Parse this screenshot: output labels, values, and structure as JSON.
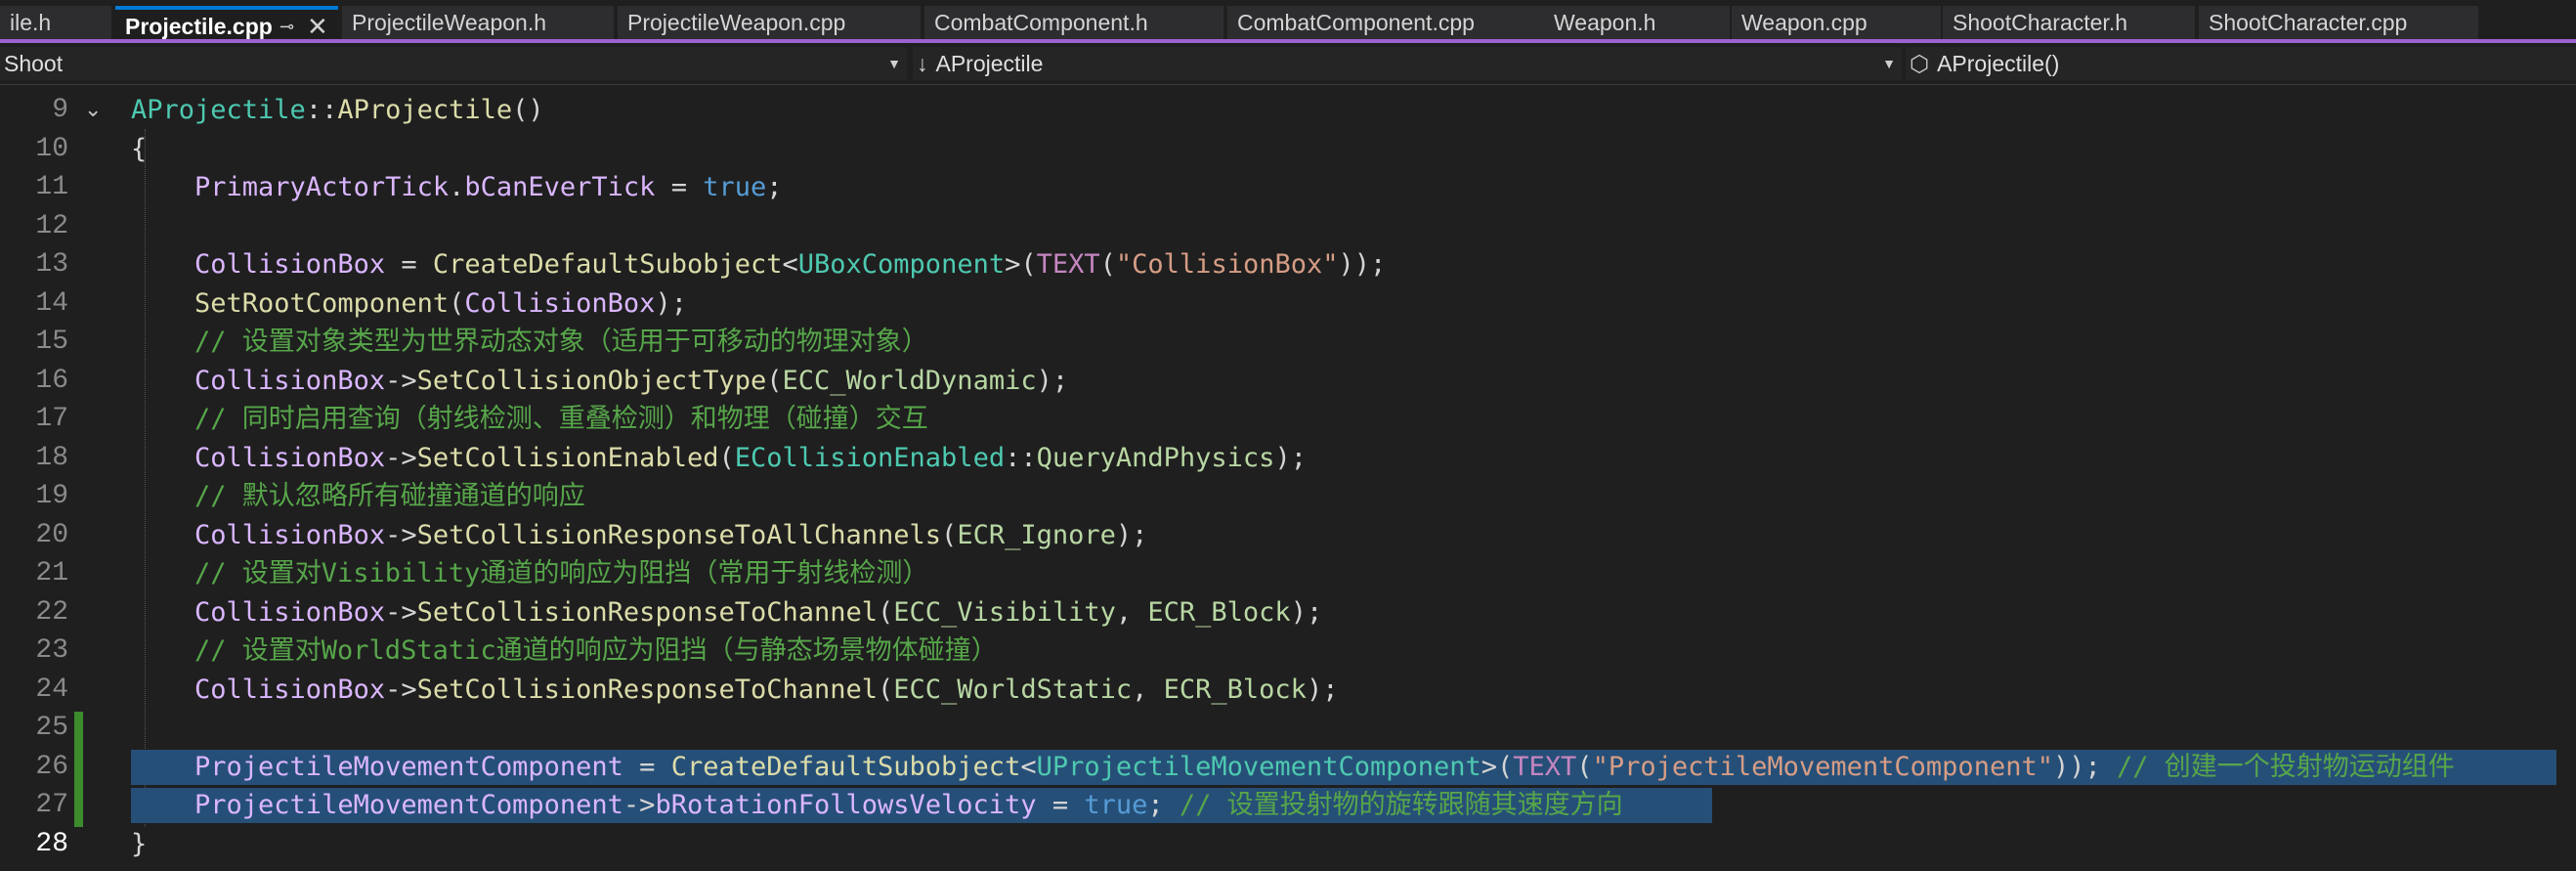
{
  "tabs": [
    {
      "label": "ile.h"
    },
    {
      "label": "Projectile.cpp",
      "active": true,
      "pin_icon": "pin-icon",
      "close_icon": "close-icon"
    },
    {
      "label": "ProjectileWeapon.h"
    },
    {
      "label": "ProjectileWeapon.cpp"
    },
    {
      "label": "CombatComponent.h"
    },
    {
      "label": "CombatComponent.cpp"
    },
    {
      "label": "Weapon.h"
    },
    {
      "label": "Weapon.cpp"
    },
    {
      "label": "ShootCharacter.h"
    },
    {
      "label": "ShootCharacter.cpp"
    }
  ],
  "nav": {
    "project": "Shoot",
    "scope": "AProjectile",
    "scope_icon": "down-arrow-icon",
    "member": "AProjectile()",
    "member_icon": "cube-icon"
  },
  "colors": {
    "keyword": "#569cd6",
    "type": "#4ec9b0",
    "function": "#dcdcaa",
    "member": "#dab6ff",
    "string": "#d69d85",
    "macro": "#c586c0",
    "comment": "#57a64a",
    "enum": "#b8d7a3",
    "selection": "#264f78",
    "change_bar": "#3c8c2e",
    "tab_accent": "#9d62cf"
  },
  "code": {
    "lines": [
      {
        "n": "9",
        "tokens": [
          {
            "t": "AProjectile",
            "c": "ty"
          },
          {
            "t": "::",
            "c": "pu"
          },
          {
            "t": "AProjectile",
            "c": "fn"
          },
          {
            "t": "()",
            "c": "pu"
          }
        ]
      },
      {
        "n": "10",
        "tokens": [
          {
            "t": "{",
            "c": "pu"
          }
        ]
      },
      {
        "n": "11",
        "tokens": [
          {
            "t": "    PrimaryActorTick",
            "c": "mb"
          },
          {
            "t": ".",
            "c": "pu"
          },
          {
            "t": "bCanEverTick",
            "c": "mb"
          },
          {
            "t": " = ",
            "c": "pu"
          },
          {
            "t": "true",
            "c": "kw"
          },
          {
            "t": ";",
            "c": "pu"
          }
        ]
      },
      {
        "n": "12",
        "tokens": []
      },
      {
        "n": "13",
        "tokens": [
          {
            "t": "    CollisionBox",
            "c": "mb"
          },
          {
            "t": " = ",
            "c": "pu"
          },
          {
            "t": "CreateDefaultSubobject",
            "c": "fn"
          },
          {
            "t": "<",
            "c": "pu"
          },
          {
            "t": "UBoxComponent",
            "c": "ty"
          },
          {
            "t": ">(",
            "c": "pu"
          },
          {
            "t": "TEXT",
            "c": "mc"
          },
          {
            "t": "(",
            "c": "pu"
          },
          {
            "t": "\"CollisionBox\"",
            "c": "st"
          },
          {
            "t": "));",
            "c": "pu"
          }
        ]
      },
      {
        "n": "14",
        "tokens": [
          {
            "t": "    SetRootComponent",
            "c": "fn"
          },
          {
            "t": "(",
            "c": "pu"
          },
          {
            "t": "CollisionBox",
            "c": "mb"
          },
          {
            "t": ");",
            "c": "pu"
          }
        ]
      },
      {
        "n": "15",
        "tokens": [
          {
            "t": "    // 设置对象类型为世界动态对象（适用于可移动的物理对象）",
            "c": "cm"
          }
        ]
      },
      {
        "n": "16",
        "tokens": [
          {
            "t": "    CollisionBox",
            "c": "mb"
          },
          {
            "t": "->",
            "c": "pu"
          },
          {
            "t": "SetCollisionObjectType",
            "c": "fn"
          },
          {
            "t": "(",
            "c": "pu"
          },
          {
            "t": "ECC_WorldDynamic",
            "c": "en"
          },
          {
            "t": ");",
            "c": "pu"
          }
        ]
      },
      {
        "n": "17",
        "tokens": [
          {
            "t": "    // 同时启用查询（射线检测、重叠检测）和物理（碰撞）交互",
            "c": "cm"
          }
        ]
      },
      {
        "n": "18",
        "tokens": [
          {
            "t": "    CollisionBox",
            "c": "mb"
          },
          {
            "t": "->",
            "c": "pu"
          },
          {
            "t": "SetCollisionEnabled",
            "c": "fn"
          },
          {
            "t": "(",
            "c": "pu"
          },
          {
            "t": "ECollisionEnabled",
            "c": "ty"
          },
          {
            "t": "::",
            "c": "pu"
          },
          {
            "t": "QueryAndPhysics",
            "c": "en"
          },
          {
            "t": ");",
            "c": "pu"
          }
        ]
      },
      {
        "n": "19",
        "tokens": [
          {
            "t": "    // 默认忽略所有碰撞通道的响应",
            "c": "cm"
          }
        ]
      },
      {
        "n": "20",
        "tokens": [
          {
            "t": "    CollisionBox",
            "c": "mb"
          },
          {
            "t": "->",
            "c": "pu"
          },
          {
            "t": "SetCollisionResponseToAllChannels",
            "c": "fn"
          },
          {
            "t": "(",
            "c": "pu"
          },
          {
            "t": "ECR_Ignore",
            "c": "en"
          },
          {
            "t": ");",
            "c": "pu"
          }
        ]
      },
      {
        "n": "21",
        "tokens": [
          {
            "t": "    // 设置对Visibility通道的响应为阻挡（常用于射线检测）",
            "c": "cm"
          }
        ]
      },
      {
        "n": "22",
        "tokens": [
          {
            "t": "    CollisionBox",
            "c": "mb"
          },
          {
            "t": "->",
            "c": "pu"
          },
          {
            "t": "SetCollisionResponseToChannel",
            "c": "fn"
          },
          {
            "t": "(",
            "c": "pu"
          },
          {
            "t": "ECC_Visibility",
            "c": "en"
          },
          {
            "t": ", ",
            "c": "pu"
          },
          {
            "t": "ECR_Block",
            "c": "en"
          },
          {
            "t": ");",
            "c": "pu"
          }
        ]
      },
      {
        "n": "23",
        "tokens": [
          {
            "t": "    // 设置对WorldStatic通道的响应为阻挡（与静态场景物体碰撞）",
            "c": "cm"
          }
        ]
      },
      {
        "n": "24",
        "tokens": [
          {
            "t": "    CollisionBox",
            "c": "mb"
          },
          {
            "t": "->",
            "c": "pu"
          },
          {
            "t": "SetCollisionResponseToChannel",
            "c": "fn"
          },
          {
            "t": "(",
            "c": "pu"
          },
          {
            "t": "ECC_WorldStatic",
            "c": "en"
          },
          {
            "t": ", ",
            "c": "pu"
          },
          {
            "t": "ECR_Block",
            "c": "en"
          },
          {
            "t": ");",
            "c": "pu"
          }
        ]
      },
      {
        "n": "25",
        "tokens": []
      },
      {
        "n": "26",
        "tokens": [
          {
            "t": "    ProjectileMovementComponent",
            "c": "mb"
          },
          {
            "t": " = ",
            "c": "pu"
          },
          {
            "t": "CreateDefaultSubobject",
            "c": "fn"
          },
          {
            "t": "<",
            "c": "pu"
          },
          {
            "t": "UProjectileMovementComponent",
            "c": "ty"
          },
          {
            "t": ">(",
            "c": "pu"
          },
          {
            "t": "TEXT",
            "c": "mc"
          },
          {
            "t": "(",
            "c": "pu"
          },
          {
            "t": "\"ProjectileMovementComponent\"",
            "c": "st"
          },
          {
            "t": ")); ",
            "c": "pu"
          },
          {
            "t": "// 创建一个投射物运动组件",
            "c": "cm"
          }
        ]
      },
      {
        "n": "27",
        "tokens": [
          {
            "t": "    ProjectileMovementComponent",
            "c": "mb"
          },
          {
            "t": "->",
            "c": "pu"
          },
          {
            "t": "bRotationFollowsVelocity",
            "c": "mb"
          },
          {
            "t": " = ",
            "c": "pu"
          },
          {
            "t": "true",
            "c": "kw"
          },
          {
            "t": "; ",
            "c": "pu"
          },
          {
            "t": "// 设置投射物的旋转跟随其速度方向",
            "c": "cm"
          }
        ]
      },
      {
        "n": "28",
        "tokens": [
          {
            "t": "}",
            "c": "pu"
          }
        ]
      }
    ]
  }
}
